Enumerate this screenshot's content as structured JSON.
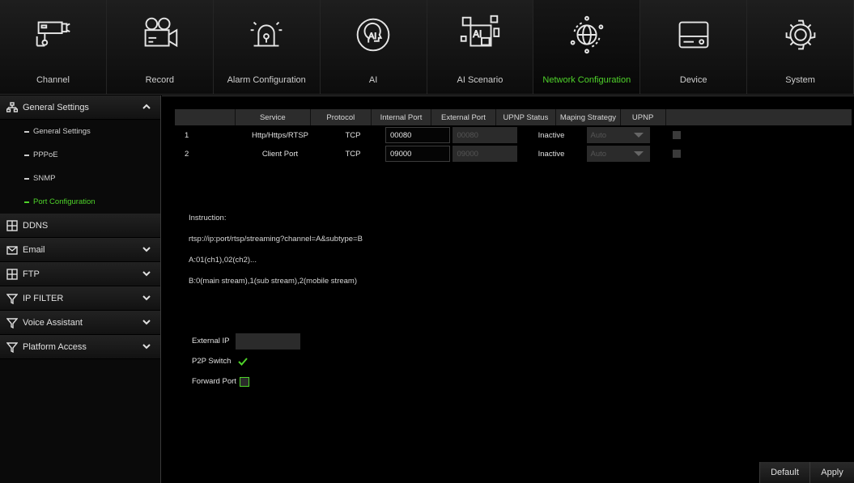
{
  "nav": [
    {
      "label": "Channel",
      "icon": "camera-icon"
    },
    {
      "label": "Record",
      "icon": "film-camera-icon"
    },
    {
      "label": "Alarm Configuration",
      "icon": "alarm-light-icon"
    },
    {
      "label": "AI",
      "icon": "ai-head-icon"
    },
    {
      "label": "AI Scenario",
      "icon": "ai-scenario-icon"
    },
    {
      "label": "Network Configuration",
      "icon": "globe-network-icon",
      "active": true
    },
    {
      "label": "Device",
      "icon": "hard-drive-icon"
    },
    {
      "label": "System",
      "icon": "gear-icon"
    }
  ],
  "sidebar": {
    "general": {
      "label": "General Settings",
      "icon": "network-icon"
    },
    "subs": [
      {
        "label": "General Settings"
      },
      {
        "label": "PPPoE"
      },
      {
        "label": "SNMP"
      },
      {
        "label": "Port Configuration",
        "active": true
      }
    ],
    "sections": [
      {
        "label": "DDNS",
        "icon": "ddns-icon"
      },
      {
        "label": "Email",
        "icon": "envelope-icon"
      },
      {
        "label": "FTP",
        "icon": "ftp-icon"
      },
      {
        "label": "IP FILTER",
        "icon": "filter-icon"
      },
      {
        "label": "Voice Assistant",
        "icon": "filter-icon"
      },
      {
        "label": "Platform Access",
        "icon": "filter-icon"
      }
    ]
  },
  "table": {
    "headers": [
      "Service",
      "Protocol",
      "Internal Port",
      "External Port",
      "UPNP Status",
      "Maping Strategy",
      "UPNP"
    ],
    "rows": [
      {
        "num": "1",
        "service": "Http/Https/RTSP",
        "protocol": "TCP",
        "internal": "00080",
        "external": "00080",
        "status": "Inactive",
        "strategy": "Auto"
      },
      {
        "num": "2",
        "service": "Client Port",
        "protocol": "TCP",
        "internal": "09000",
        "external": "09000",
        "status": "Inactive",
        "strategy": "Auto"
      }
    ]
  },
  "instructions": [
    "Instruction:",
    "rtsp://ip:port/rtsp/streaming?channel=A&subtype=B",
    "A:01(ch1),02(ch2)...",
    "B:0(main stream),1(sub stream),2(mobile stream)"
  ],
  "fields": {
    "external_ip": {
      "label": "External IP",
      "value": ""
    },
    "p2p_switch": {
      "label": "P2P Switch",
      "checked": true
    },
    "forward_port": {
      "label": "Forward Port",
      "checked": false
    }
  },
  "buttons": {
    "default": "Default",
    "apply": "Apply"
  },
  "colors": {
    "accent": "#4fd32a",
    "background": "#000000"
  }
}
